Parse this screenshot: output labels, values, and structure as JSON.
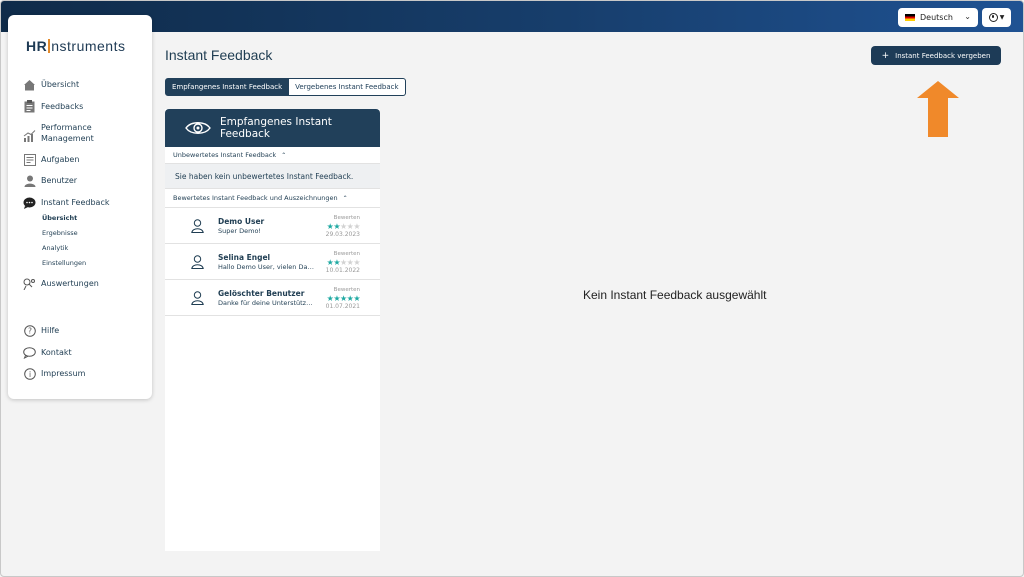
{
  "topbar": {
    "language": "Deutsch"
  },
  "sidebar": {
    "logo_bold": "HR",
    "logo_light": "nstruments",
    "items": [
      {
        "label": "Übersicht",
        "icon": "home-icon"
      },
      {
        "label": "Feedbacks",
        "icon": "clipboard-icon"
      },
      {
        "label": "Performance Management",
        "icon": "chart-icon"
      },
      {
        "label": "Aufgaben",
        "icon": "tasks-icon"
      },
      {
        "label": "Benutzer",
        "icon": "user-icon"
      },
      {
        "label": "Instant Feedback",
        "icon": "chat-bubble-icon"
      }
    ],
    "sub_items": [
      "Übersicht",
      "Ergebnisse",
      "Analytik",
      "Einstellungen"
    ],
    "auswertungen": "Auswertungen",
    "footer_items": [
      "Hilfe",
      "Kontakt",
      "Impressum"
    ]
  },
  "main": {
    "title": "Instant Feedback",
    "tabs": [
      "Empfangenes Instant Feedback",
      "Vergebenes Instant Feedback"
    ],
    "give_button": "Instant Feedback vergeben",
    "empty_selection": "Kein Instant Feedback ausgewählt"
  },
  "panel": {
    "title_line1": "Empfangenes Instant",
    "title_line2": "Feedback",
    "unrated_section": "Unbewertetes Instant Feedback",
    "unrated_empty": "Sie haben kein unbewertetes Instant Feedback.",
    "rated_section": "Bewertetes Instant Feedback und Auszeichnungen",
    "rate_label": "Bewerten",
    "feedbacks": [
      {
        "name": "Demo User",
        "text": "Super Demo!",
        "date": "29.03.2023",
        "rating": 2,
        "max": 5
      },
      {
        "name": "Selina Engel",
        "text": "Hallo Demo User, vielen Dan...",
        "date": "10.01.2022",
        "rating": 2,
        "max": 5
      },
      {
        "name": "Gelöschter Benutzer",
        "text": "Danke für deine Unterstützu...",
        "date": "01.07.2021",
        "rating": 5,
        "max": 5
      }
    ]
  },
  "colors": {
    "navy": "#21405a",
    "accent_orange": "#f0892a",
    "star_teal": "#1fa9a2"
  }
}
